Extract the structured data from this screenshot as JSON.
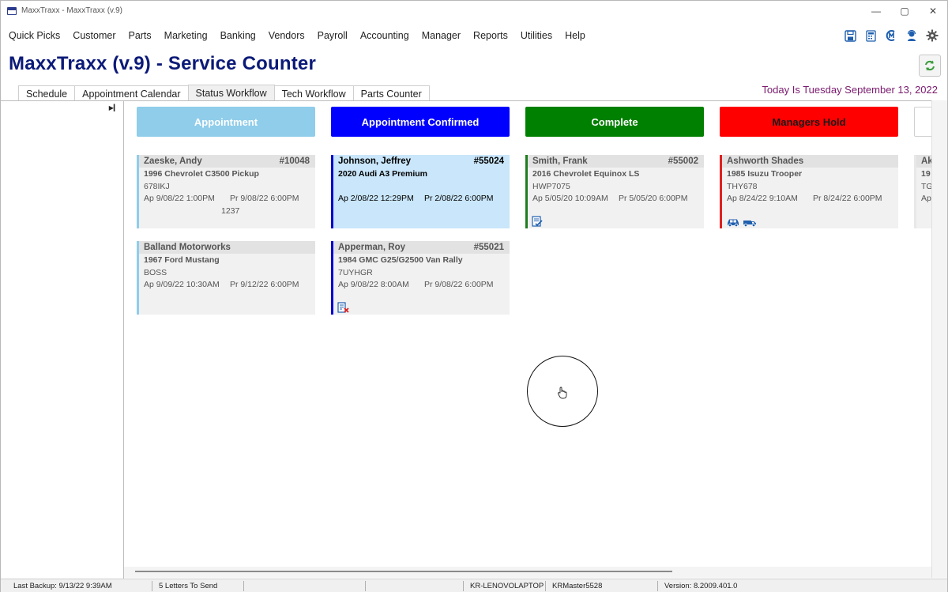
{
  "window": {
    "title": "MaxxTraxx - MaxxTraxx (v.9)"
  },
  "menu": [
    "Quick Picks",
    "Customer",
    "Parts",
    "Marketing",
    "Banking",
    "Vendors",
    "Payroll",
    "Accounting",
    "Manager",
    "Reports",
    "Utilities",
    "Help"
  ],
  "toolbar_icons": [
    "save-icon",
    "calculator-icon",
    "maxxtraxx-logo-icon",
    "support-agent-icon",
    "settings-gear-icon"
  ],
  "app_title": "MaxxTraxx (v.9) - Service Counter",
  "tabs": [
    "Schedule",
    "Appointment Calendar",
    "Status Workflow",
    "Tech Workflow",
    "Parts Counter"
  ],
  "active_tab": "Status Workflow",
  "date_text": "Today Is Tuesday September 13, 2022",
  "columns": [
    {
      "label": "Appointment",
      "bg": "#8fcdea",
      "fg": "#ffffff",
      "border": "#8fcdea"
    },
    {
      "label": "Appointment Confirmed",
      "bg": "#0000ff",
      "fg": "#ffffff",
      "border": "#0000cc"
    },
    {
      "label": "Complete",
      "bg": "#008000",
      "fg": "#ffffff",
      "border": "#1e7d1e"
    },
    {
      "label": "Managers Hold",
      "bg": "#ff0000",
      "fg": "#1a1a1a",
      "border": "#e02020"
    }
  ],
  "cards": {
    "c0_0": {
      "name": "Zaeske, Andy",
      "number": "#10048",
      "vehicle": "1996 Chevrolet C3500 Pickup",
      "plate": "678IKJ",
      "appt": "Ap 9/08/22  1:00PM",
      "promised": "Pr 9/08/22  6:00PM",
      "extra": "1237"
    },
    "c0_1": {
      "name": "Balland Motorworks",
      "number": "",
      "vehicle": "1967 Ford Mustang",
      "plate": "BOSS",
      "appt": "Ap 9/09/22 10:30AM",
      "promised": "Pr 9/12/22  6:00PM"
    },
    "c1_0": {
      "name": "Johnson, Jeffrey",
      "number": "#55024",
      "vehicle": "2020 Audi A3 Premium",
      "plate": "",
      "appt": "Ap 2/08/22 12:29PM",
      "promised": "Pr 2/08/22  6:00PM"
    },
    "c1_1": {
      "name": "Apperman, Roy",
      "number": "#55021",
      "vehicle": "1984 GMC G25/G2500 Van Rally",
      "plate": "7UYHGR",
      "appt": "Ap 9/08/22  8:00AM",
      "promised": "Pr 9/08/22  6:00PM"
    },
    "c2_0": {
      "name": "Smith, Frank",
      "number": "#55002",
      "vehicle": "2016 Chevrolet Equinox LS",
      "plate": "HWP7075",
      "appt": "Ap 5/05/20 10:09AM",
      "promised": "Pr 5/05/20  6:00PM"
    },
    "c3_0": {
      "name": "Ashworth Shades",
      "number": "",
      "vehicle": "1985 Isuzu Trooper",
      "plate": "THY678",
      "appt": "Ap 8/24/22  9:10AM",
      "promised": "Pr 8/24/22  6:00PM"
    },
    "c4_0": {
      "name": "Ak",
      "vehicle": "19",
      "plate": "TG",
      "appt": "Ap"
    }
  },
  "status": {
    "backup": "Last Backup:  9/13/22  9:39AM",
    "letters": "5 Letters To Send",
    "computer": "KR-LENOVOLAPTOP",
    "user": "KRMaster5528",
    "version": "Version:  8.2009.401.0"
  }
}
